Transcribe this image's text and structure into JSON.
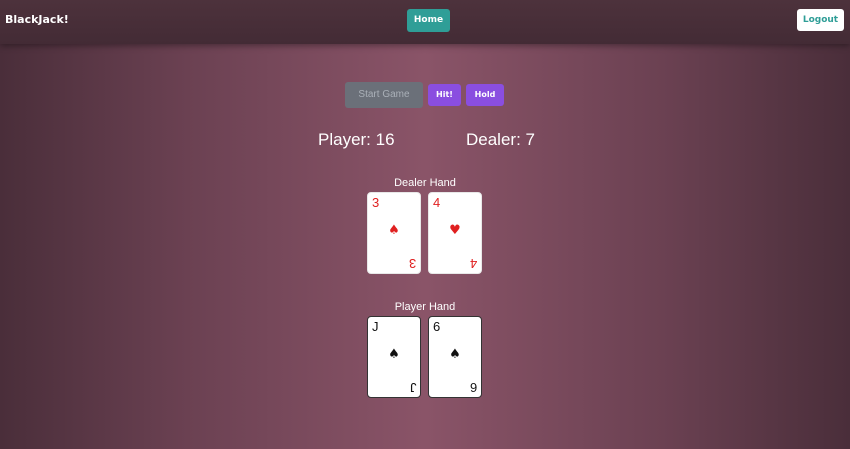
{
  "navbar": {
    "brand": "BlackJack!",
    "home_label": "Home",
    "logout_label": "Logout"
  },
  "controls": {
    "start_label": "Start Game",
    "hit_label": "Hit!",
    "hold_label": "Hold"
  },
  "scores": {
    "player": "Player: 16",
    "dealer": "Dealer: 7"
  },
  "dealer_hand": {
    "label": "Dealer Hand",
    "cards": [
      {
        "rank": "3",
        "suit": "♠",
        "suit_name": "spade-icon",
        "color": "#e02020"
      },
      {
        "rank": "4",
        "suit": "♥",
        "suit_name": "heart-icon",
        "color": "#e02020"
      }
    ]
  },
  "player_hand": {
    "label": "Player Hand",
    "cards": [
      {
        "rank": "J",
        "suit": "♠",
        "suit_name": "spade-icon",
        "color": "#111111"
      },
      {
        "rank": "6",
        "suit": "♠",
        "suit_name": "spade-icon",
        "color": "#111111"
      }
    ]
  }
}
